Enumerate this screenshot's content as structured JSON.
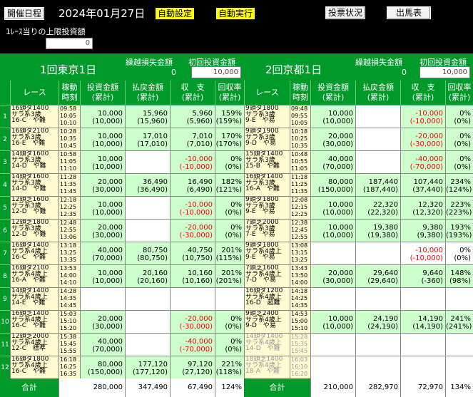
{
  "toolbar": {
    "date_btn": "開催日程",
    "date": "2024年01月27日",
    "auto_set": "自動設定",
    "auto_run": "自動実行",
    "vote_status": "投票状況",
    "runners": "出馬表",
    "limit_label": "1ﾚｰｽ当りの上限投資額",
    "limit_value": "0"
  },
  "left": {
    "venue": "1回東京1日",
    "carry_label": "繰越損失金額",
    "carry_value": "0",
    "first_label": "初回投資金額",
    "first_value": "10,000"
  },
  "right": {
    "venue": "2回京都1日",
    "carry_label": "繰越損失金額",
    "carry_value": "0",
    "first_label": "初回投資金額",
    "first_value": "10,000"
  },
  "columns": {
    "race": "レース",
    "time": "稼動\n時刻",
    "invest": "投資金額\n(累計)",
    "payout": "払戻金額\n(累計)",
    "balance": "収　支\n(累計)",
    "ratio": "回収率\n(累計)"
  },
  "rows": [
    {
      "n": "1",
      "L": {
        "race": "16頭ダ1400\nサラ系3歳\n16-C　や難",
        "time": "09:58\n10:05\n10:10",
        "inv": "10,000\n(10,000)",
        "pay": "15,960\n(15,960)",
        "bal": "5,960\n(5,960)",
        "rat": "159%\n(159%)",
        "neg": false,
        "hit": true
      },
      "R": {
        "race": "9頭ダ1800\nサラ系3歳\n9-E　や易",
        "time": "09:48\n09:55\n10:05",
        "inv": "10,000\n(10,000)",
        "pay": "",
        "bal": "-10,000\n(-10,000)",
        "rat": "0%\n(0%)",
        "neg": true,
        "hit": false
      }
    },
    {
      "n": "2",
      "L": {
        "race": "16頭ダ2100\nサラ系3歳\n16-E　や難",
        "time": "10:28\n10:35\n10:45",
        "inv": "10,000\n(10,000)",
        "pay": "17,010\n(17,010)",
        "bal": "7,010\n(7,010)",
        "rat": "170%\n(170%)",
        "neg": false,
        "hit": true
      },
      "R": {
        "race": "9頭ダ1900\nサラ系3歳\n9-D　や易",
        "time": "10:18\n10:25\n10:35",
        "inv": "20,000\n(30,000)",
        "pay": "",
        "bal": "-20,000\n(-30,000)",
        "rat": "0%\n(0%)",
        "neg": true,
        "hit": false
      }
    },
    {
      "n": "3",
      "L": {
        "race": "14頭ダ1600\nサラ系3歳\n14-D　や難",
        "time": "10:58\n11:05\n11:10",
        "inv": "10,000\n(10,000)",
        "pay": "",
        "bal": "-10,000\n(-10,000)",
        "rat": "0%\n(0%)",
        "neg": true,
        "hit": false
      },
      "R": {
        "race": "15頭ダ1400\nサラ系3歳\n15-B　や難",
        "time": "10:48\n10:55\n11:05",
        "inv": "40,000\n(70,000)",
        "pay": "",
        "bal": "-40,000\n(-70,000)",
        "rat": "0%\n(0%)",
        "neg": true,
        "hit": false
      }
    },
    {
      "n": "4",
      "L": {
        "race": "14頭ダ1600\nサラ系3歳\n14-D　や難",
        "time": "11:28\n11:35\n11:45",
        "inv": "20,000\n(30,000)",
        "pay": "36,490\n(36,490)",
        "bal": "16,490\n(6,490)",
        "rat": "182%\n(121%)",
        "neg": false,
        "hit": true
      },
      "R": {
        "race": "16頭ダ1400\nサラ系3歳\n16-A　や難",
        "time": "11:18\n11:25\n11:35",
        "inv": "80,000\n(150,000)",
        "pay": "187,440\n(187,440)",
        "bal": "107,440\n(37,440)",
        "rat": "234%\n(124%)",
        "neg": false,
        "hit": true
      }
    },
    {
      "n": "5",
      "L": {
        "race": "12頭芝1600\nサラ系3歳\n12-D　や難",
        "time": "12:18\n12:25\n12:35",
        "inv": "10,000\n(10,000)",
        "pay": "",
        "bal": "-10,000\n(-10,000)",
        "rat": "0%\n(0%)",
        "neg": true,
        "hit": false
      },
      "R": {
        "race": "9頭ダ1800\nサラ系3歳\n9-E　や易",
        "time": "12:08\n12:15\n12:25",
        "inv": "10,000\n(10,000)",
        "pay": "22,320\n(22,320)",
        "bal": "12,320\n(12,320)",
        "rat": "223%\n(223%)",
        "neg": false,
        "hit": true
      }
    },
    {
      "n": "6",
      "L": {
        "race": "12頭芝1800\nサラ系3歳\n12-D　や難",
        "time": "12:48\n12:55\n13:06",
        "inv": "20,000\n(30,000)",
        "pay": "",
        "bal": "-20,000\n(-30,000)",
        "rat": "0%\n(0%)",
        "neg": true,
        "hit": false
      },
      "R": {
        "race": "7頭芝2000\nサラ系3歳\n7-E　や易",
        "time": "12:38\n12:45\n12:55",
        "inv": "10,000\n(10,000)",
        "pay": "19,380\n(19,380)",
        "bal": "9,380\n(9,380)",
        "rat": "193%\n(193%)",
        "neg": false,
        "hit": true
      }
    },
    {
      "n": "7",
      "L": {
        "race": "16頭ダ1400\nサラ系4歳上\n16-C　や難",
        "time": "13:18\n13:25\n13:35",
        "inv": "40,000\n(70,000)",
        "pay": "80,750\n(80,750)",
        "bal": "40,750\n(10,750)",
        "rat": "201%\n(115%)",
        "neg": false,
        "hit": true
      },
      "R": {
        "race": "9頭ダ1800\nサラ系4歳上\n9-E　や易",
        "time": "13:08\n13:15\n13:25",
        "inv": "",
        "pay": "",
        "bal": "-10,000\n(-10,000)",
        "rat": "0%\n(0%)",
        "neg": true,
        "hit": false
      }
    },
    {
      "n": "8",
      "L": {
        "race": "16頭ダ2100\nサラ系4歳上\n16-A　や難",
        "time": "13:53\n14:00\n14:10",
        "inv": "10,000\n(10,000)",
        "pay": "20,160\n(20,160)",
        "bal": "10,160\n(10,160)",
        "rat": "201%\n(201%)",
        "neg": false,
        "hit": true
      },
      "R": {
        "race": "7頭芝1600\nサラ系4歳上\n7-D　や易",
        "time": "13:43\n13:50\n14:00",
        "inv": "20,000\n(30,000)",
        "pay": "29,640\n(29,640)",
        "bal": "9,640\n(-360)",
        "rat": "148%\n(98%)",
        "neg": false,
        "hit": true
      }
    },
    {
      "n": "9",
      "L": {
        "race": "14頭ダ1400\nサラ系4歳上\n14-E　や難",
        "time": "14:28\n14:35\n14:45",
        "inv": "",
        "pay": "",
        "bal": "",
        "rat": "",
        "neg": false,
        "hit": false
      },
      "R": {
        "race": "16頭ダ1200\nサラ系4歳上\n16-D　超難",
        "time": "14:18\n14:25\n14:35",
        "inv": "",
        "pay": "",
        "bal": "",
        "rat": "",
        "neg": false,
        "hit": false
      }
    },
    {
      "n": "10",
      "L": {
        "race": "16頭芝1400\nサラ系4歳上\n16-C　や難",
        "time": "15:03\n15:10\n15:20",
        "inv": "20,000\n(30,000)",
        "pay": "",
        "bal": "-20,000\n(-30,000)",
        "rat": "0%\n(0%)",
        "neg": true,
        "hit": false
      },
      "R": {
        "race": "9頭芝2400\nサラ系4歳上\n9-D　や易",
        "time": "14:53\n15:00\n15:10",
        "inv": "10,000\n(10,000)",
        "pay": "24,190\n(24,190)",
        "bal": "14,190\n(14,190)",
        "rat": "241%\n(241%)",
        "neg": false,
        "hit": true
      }
    },
    {
      "n": "11",
      "L": {
        "race": "12頭芝2000\nサラ系4歳上\n12-C　標準",
        "time": "15:38\n15:45\n15:55",
        "inv": "40,000\n(70,000)",
        "pay": "",
        "bal": "-40,000\n(-70,000)",
        "rat": "0%\n(0%)",
        "neg": true,
        "hit": false
      },
      "R": {
        "race": "14頭ダ1400\nサラ系4歳上\n14-D　や難",
        "time": "15:28\n15:35\n15:45",
        "inv": "",
        "pay": "",
        "bal": "",
        "rat": "",
        "neg": false,
        "hit": false,
        "grey": true
      }
    },
    {
      "n": "12",
      "L": {
        "race": "16頭ダ1800\nサラ系4歳上\n16-C　や難",
        "time": "16:18\n16:25\n16:35",
        "inv": "80,000\n(150,000)",
        "pay": "177,120\n(177,120)",
        "bal": "97,120\n(27,120)",
        "rat": "221%\n(118%)",
        "neg": false,
        "hit": true
      },
      "R": {
        "race": "18頭芝1400\nサラ系4歳上\n18-A　や難",
        "time": "16:03\n16:10\n16:20",
        "inv": "",
        "pay": "",
        "bal": "",
        "rat": "",
        "neg": false,
        "hit": false,
        "grey": true
      }
    }
  ],
  "totals": {
    "label": "合計",
    "L": {
      "inv": "280,000",
      "pay": "347,490",
      "bal": "67,490",
      "rat": "124%"
    },
    "R": {
      "inv": "210,000",
      "pay": "282,970",
      "bal": "72,970",
      "rat": "134%"
    }
  }
}
